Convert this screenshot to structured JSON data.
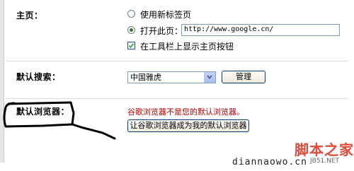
{
  "homepage": {
    "label": "主页：",
    "option_new_tab": "使用新标签页",
    "option_open_page": "打开此页：",
    "url_value": "http://www.google.cn/",
    "show_home_button": "在工具栏上显示主页按钮",
    "selected": "open_page",
    "show_home_checked": true
  },
  "search": {
    "label": "默认搜索：",
    "selected_engine": "中国雅虎",
    "manage_button": "管理"
  },
  "browser": {
    "label": "默认浏览器：",
    "status_text": "谷歌浏览器不是您的默认浏览器。",
    "set_default_button": "让谷歌浏览器成为我的默认浏览器",
    "status_color": "#b00000"
  },
  "watermark": {
    "text": "diannaowo.cn",
    "logo_text": "脚本之家",
    "logo_sub": "JB51.NET",
    "logo_color": "#e04a3a"
  },
  "icons": {
    "dropdown": "chevron-down-icon",
    "check": "check-icon",
    "annotation": "hand-drawn-circle"
  }
}
